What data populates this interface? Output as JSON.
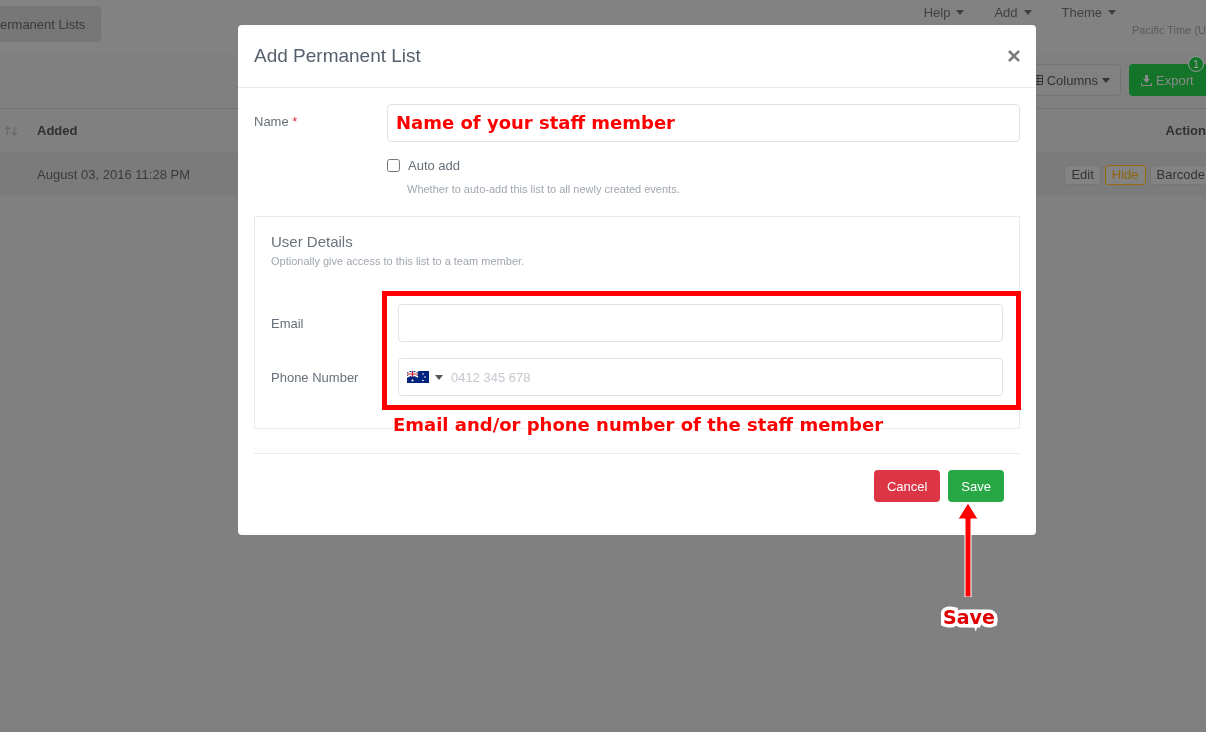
{
  "header": {
    "tab": "ermanent Lists",
    "menus": [
      {
        "label": "Help"
      },
      {
        "label": "Add"
      },
      {
        "label": "Theme"
      }
    ],
    "timezone": "Pacific Time (U"
  },
  "toolbar": {
    "columns_button": "Columns",
    "export_button": "Export",
    "export_badge": "1"
  },
  "table": {
    "columns": [
      "Added",
      "Action"
    ],
    "rows": [
      {
        "added": "August 03, 2016 11:28 PM",
        "actions": [
          {
            "label": "Edit",
            "kind": "plain"
          },
          {
            "label": "Hide",
            "kind": "warning"
          },
          {
            "label": "Barcode",
            "kind": "plain"
          }
        ]
      }
    ]
  },
  "modal": {
    "title": "Add Permanent List",
    "name_field": {
      "label": "Name",
      "required_mark": "*"
    },
    "auto_add": {
      "label": "Auto add",
      "checked": false,
      "help": "Whether to auto-add this list to all newly created events."
    },
    "user_details": {
      "title": "User Details",
      "subtitle": "Optionally give access to this list to a team member.",
      "email": {
        "label": "Email"
      },
      "phone": {
        "label": "Phone Number",
        "placeholder": "0412 345 678"
      }
    },
    "buttons": [
      {
        "label": "Cancel",
        "kind": "danger"
      },
      {
        "label": "Save",
        "kind": "success"
      }
    ]
  },
  "annotations": [
    {
      "kind": "field_text",
      "text": "Name of your staff member"
    },
    {
      "kind": "box_caption",
      "text": "Email and/or phone number of the staff member"
    },
    {
      "kind": "arrow_caption",
      "text": "Save"
    }
  ]
}
